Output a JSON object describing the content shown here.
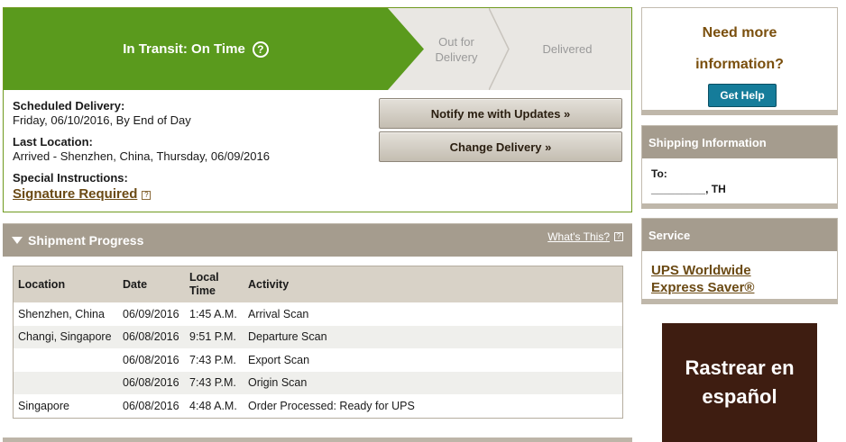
{
  "status": {
    "current_step": "In Transit: On Time",
    "steps": [
      "Out for Delivery",
      "Delivered"
    ],
    "help_glyph": "?"
  },
  "details": {
    "scheduled_label": "Scheduled Delivery:",
    "scheduled_value": "Friday, 06/10/2016, By End of Day",
    "last_location_label": "Last Location:",
    "last_location_value": "Arrived - Shenzhen, China, Thursday, 06/09/2016",
    "instructions_label": "Special Instructions:",
    "signature_link": "Signature Required",
    "mini_help": "?"
  },
  "actions": {
    "notify_label": "Notify me with Updates »",
    "change_label": "Change Delivery »"
  },
  "progress": {
    "title": "Shipment Progress",
    "whats_this": "What's This?",
    "mini_help": "?",
    "columns": [
      "Location",
      "Date",
      "Local Time",
      "Activity"
    ],
    "rows": [
      {
        "location": "Shenzhen, China",
        "date": "06/09/2016",
        "time": "1:45 A.M.",
        "activity": "Arrival Scan"
      },
      {
        "location": "Changi, Singapore",
        "date": "06/08/2016",
        "time": "9:51 P.M.",
        "activity": "Departure Scan"
      },
      {
        "location": "",
        "date": "06/08/2016",
        "time": "7:43 P.M.",
        "activity": "Export Scan"
      },
      {
        "location": "",
        "date": "06/08/2016",
        "time": "7:43 P.M.",
        "activity": "Origin Scan"
      },
      {
        "location": "Singapore",
        "date": "06/08/2016",
        "time": "4:48 A.M.",
        "activity": "Order Processed: Ready for UPS"
      }
    ]
  },
  "sidebar": {
    "need_info_line1": "Need more",
    "need_info_line2": "information?",
    "get_help": "Get Help",
    "shipping_header": "Shipping Information",
    "to_label": "To:",
    "to_value": "_________, TH",
    "service_header": "Service",
    "service_line1": "UPS Worldwide",
    "service_line2": "Express Saver®",
    "espanol_line1": "Rastrear en",
    "espanol_line2": "español"
  },
  "colors": {
    "green": "#5a9a1d",
    "taupe": "#a59c8e",
    "link_brown": "#6b4a14",
    "help_blue": "#157c9a",
    "dark_brown": "#3e1d11"
  }
}
